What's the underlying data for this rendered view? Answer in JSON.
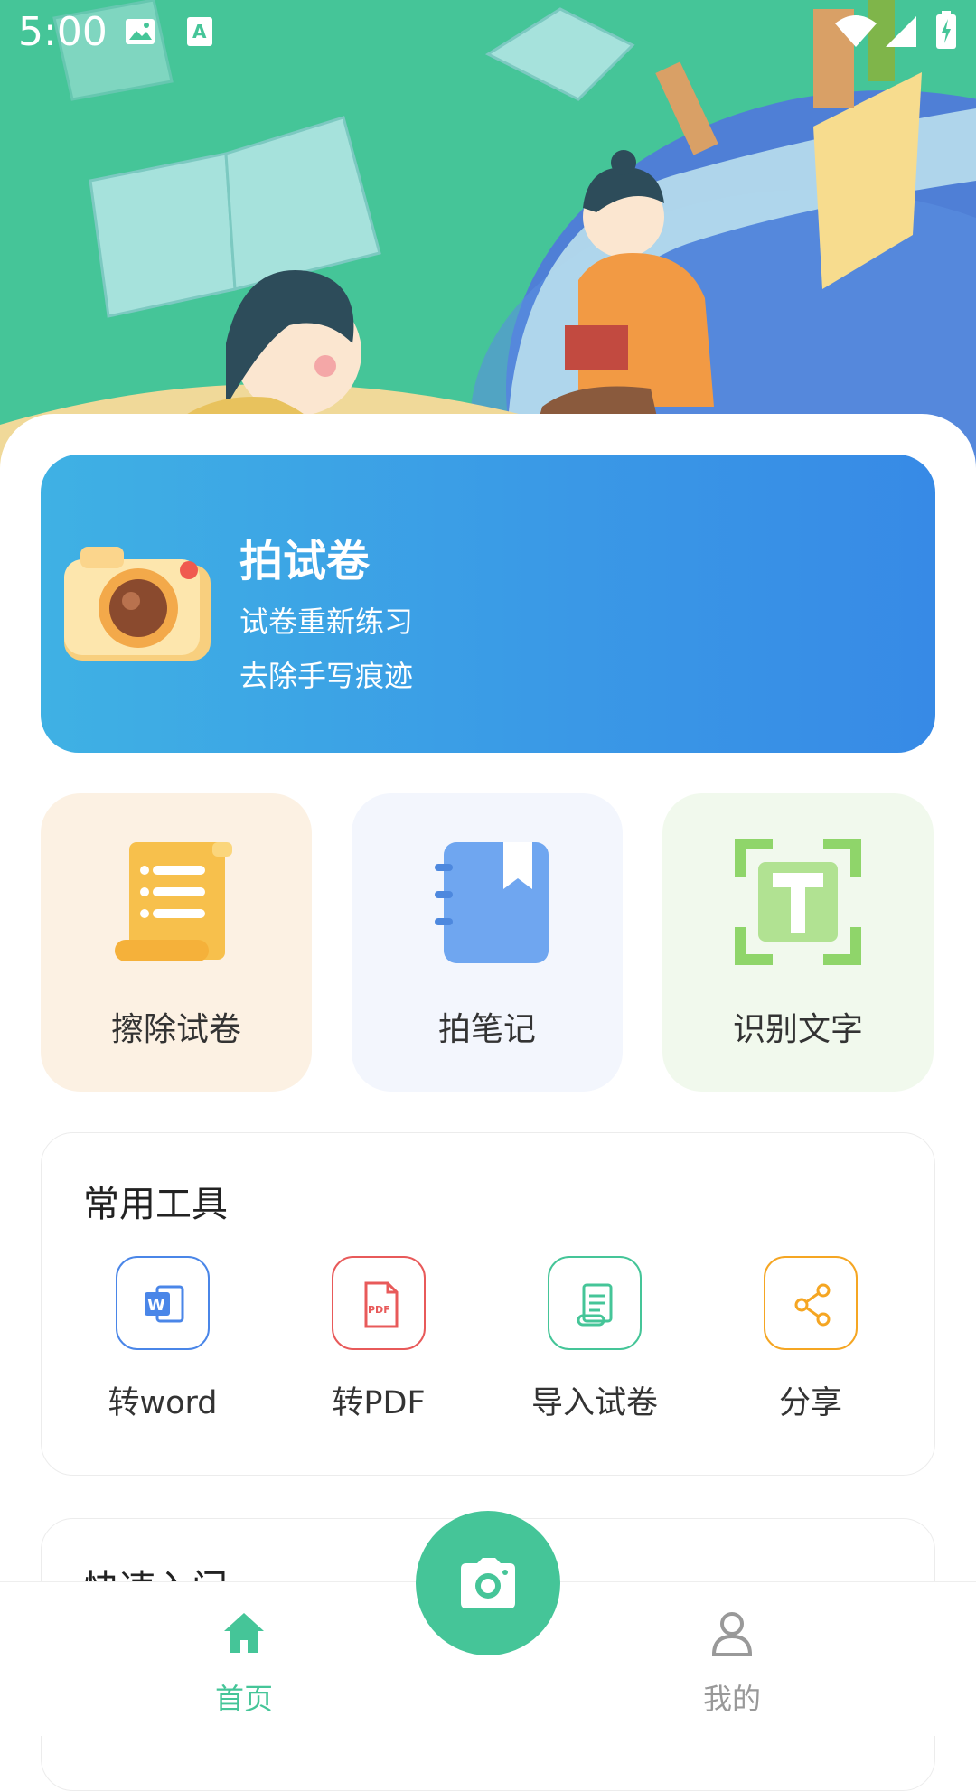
{
  "status_bar": {
    "time": "5:00"
  },
  "banner": {
    "title": "拍试卷",
    "line1": "试卷重新练习",
    "line2": "去除手写痕迹"
  },
  "features": [
    {
      "label": "擦除试卷",
      "icon": "scroll-document-icon"
    },
    {
      "label": "拍笔记",
      "icon": "notebook-icon"
    },
    {
      "label": "识别文字",
      "icon": "text-recognition-icon"
    }
  ],
  "tools": {
    "title": "常用工具",
    "items": [
      {
        "label": "转word",
        "icon": "word-doc-icon",
        "color": "#4a86e8"
      },
      {
        "label": "转PDF",
        "icon": "pdf-doc-icon",
        "color": "#e85a5a"
      },
      {
        "label": "导入试卷",
        "icon": "import-scroll-icon",
        "color": "#45c598"
      },
      {
        "label": "分享",
        "icon": "share-icon",
        "color": "#f5a623"
      }
    ]
  },
  "quick_start": {
    "title": "快速入门"
  },
  "nav": {
    "home": {
      "label": "首页",
      "color": "#45c598"
    },
    "profile": {
      "label": "我的",
      "color": "#999999"
    }
  },
  "colors": {
    "accent": "#45c598",
    "banner_start": "#3fb1e4",
    "banner_end": "#378ae6"
  }
}
